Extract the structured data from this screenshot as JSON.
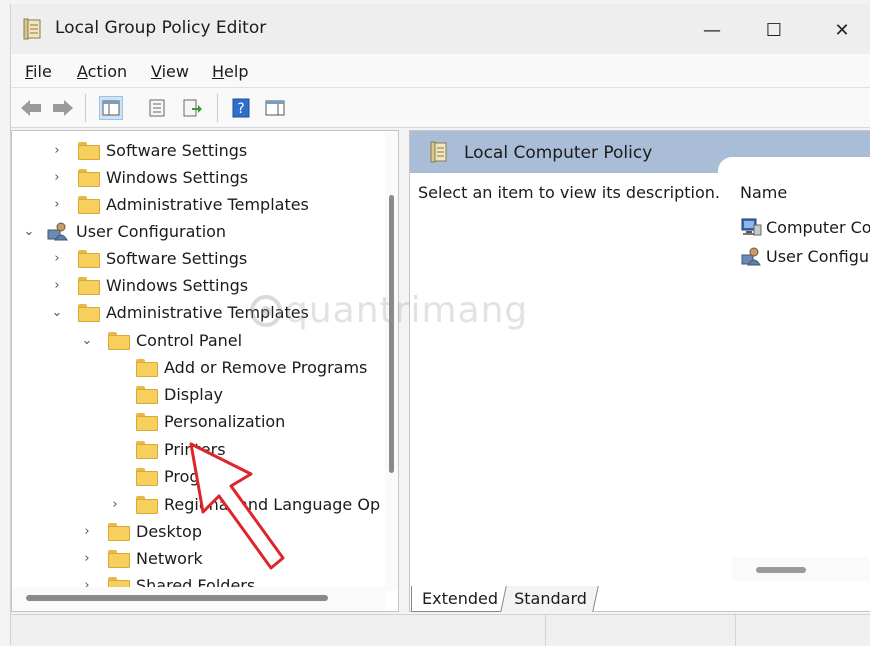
{
  "window": {
    "title": "Local Group Policy Editor",
    "controls": {
      "minimize": "—",
      "maximize": "☐",
      "close": "✕"
    }
  },
  "menu": [
    {
      "accel": "F",
      "rest": "ile"
    },
    {
      "accel": "A",
      "rest": "ction"
    },
    {
      "accel": "V",
      "rest": "iew"
    },
    {
      "accel": "H",
      "rest": "elp"
    }
  ],
  "toolbar": {
    "icons": [
      "back-arrow-icon",
      "forward-arrow-icon",
      "show-hide-tree-icon",
      "properties-icon",
      "export-list-icon",
      "help-icon",
      "show-hide-action-pane-icon"
    ],
    "help_glyph": "?"
  },
  "tree": {
    "items": [
      {
        "label": "Software Settings",
        "chevron": "›"
      },
      {
        "label": "Windows Settings",
        "chevron": "›"
      },
      {
        "label": "Administrative Templates",
        "chevron": "›"
      },
      {
        "label": "User Configuration",
        "chevron": "⌄"
      },
      {
        "label": "Software Settings",
        "chevron": "›"
      },
      {
        "label": "Windows Settings",
        "chevron": "›"
      },
      {
        "label": "Administrative Templates",
        "chevron": "⌄"
      },
      {
        "label": "Control Panel",
        "chevron": "⌄"
      },
      {
        "label": "Add or Remove Programs",
        "chevron": ""
      },
      {
        "label": "Display",
        "chevron": ""
      },
      {
        "label": "Personalization",
        "chevron": ""
      },
      {
        "label": "Printers",
        "chevron": ""
      },
      {
        "label": "Programs",
        "chevron": ""
      },
      {
        "label": "Regional and Language Op",
        "chevron": "›"
      },
      {
        "label": "Desktop",
        "chevron": "›"
      },
      {
        "label": "Network",
        "chevron": "›"
      },
      {
        "label": "Shared Folders",
        "chevron": "›"
      }
    ]
  },
  "right_pane": {
    "header_title": "Local Computer Policy",
    "description": "Select an item to view its description.",
    "column_name": "Name",
    "items": [
      {
        "label": "Computer Co"
      },
      {
        "label": "User Configur"
      }
    ]
  },
  "tabs": [
    {
      "label": "Extended"
    },
    {
      "label": "Standard"
    }
  ],
  "watermark": "quantrimang",
  "colors": {
    "header_band": "#a9bed6",
    "folder_yellow": "#f6cf5c",
    "annotation_arrow": "#e0242b"
  }
}
